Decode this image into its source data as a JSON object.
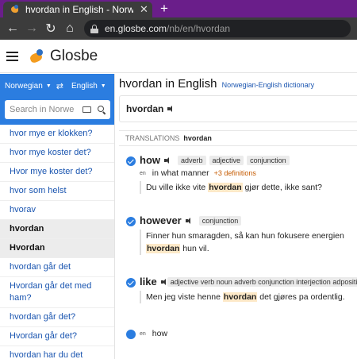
{
  "browser": {
    "tab_title": "hvordan in English - Norwegian-E",
    "new_tab": "+",
    "close": "✕",
    "url_domain": "en.glosbe.com",
    "url_path": "/nb/en/hvordan"
  },
  "site": {
    "logo_text": "Glosbe"
  },
  "sidebar": {
    "source_lang": "Norwegian",
    "target_lang": "English",
    "search_placeholder": "Search in Norwe",
    "items": [
      {
        "label": "hvor mye er klokken?",
        "active": false
      },
      {
        "label": "hvor mye koster det?",
        "active": false
      },
      {
        "label": "Hvor mye koster det?",
        "active": false
      },
      {
        "label": "hvor som helst",
        "active": false
      },
      {
        "label": "hvorav",
        "active": false
      },
      {
        "label": "hvordan",
        "active": true
      },
      {
        "label": "Hvordan",
        "active": true
      },
      {
        "label": "hvordan går det",
        "active": false
      },
      {
        "label": "Hvordan går det med ham?",
        "active": false
      },
      {
        "label": "hvordan går det?",
        "active": false
      },
      {
        "label": "Hvordan går det?",
        "active": false
      },
      {
        "label": "hvordan har du det",
        "active": false
      }
    ]
  },
  "main": {
    "title": "hvordan in English",
    "subtitle": "Norwegian-English dictionary",
    "word": "hvordan",
    "translations_label": "TRANSLATIONS",
    "translations_word": "hvordan",
    "entries": {
      "how": {
        "term": "how",
        "tags": [
          "adverb",
          "adjective",
          "conjunction"
        ],
        "lang": "en",
        "meaning": "in what manner",
        "more_defs": "+3 definitions",
        "example_before": "Du ville ikke vite ",
        "example_hl": "hvordan",
        "example_after": " gjør dette, ikke sant?"
      },
      "however": {
        "term": "however",
        "tags": [
          "conjunction"
        ],
        "example_line1": "Finner hun smaragden, så kan hun fokusere energien",
        "example_hl": "hvordan",
        "example_after": " hun vil."
      },
      "like": {
        "term": "like",
        "tags": [
          "adjective verb noun adverb conjunction interjection adposition"
        ],
        "example_before": "Men jeg viste henne ",
        "example_hl": "hvordan",
        "example_after": " det gjøres pa ordentlig."
      },
      "how2": {
        "lang": "en",
        "term": "how"
      }
    }
  }
}
